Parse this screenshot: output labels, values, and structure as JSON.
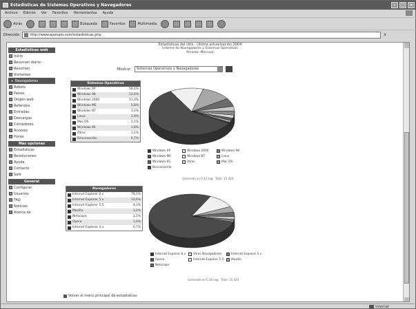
{
  "window": {
    "title": "Estadisticas de Sistemas Operativos y Navegadores"
  },
  "menubar": {
    "items": [
      "Archivo",
      "Edición",
      "Ver",
      "Favoritos",
      "Herramientas",
      "Ayuda"
    ]
  },
  "toolbar": {
    "back_label": "Atrás",
    "search_label": "Búsqueda",
    "favorites_label": "Favoritos",
    "multimedia_label": "Multimedia"
  },
  "address": {
    "label": "Dirección",
    "url": "http://www.ejemplo.com/estadisticas.php",
    "go_label": "Ir"
  },
  "sidebar": {
    "sections": [
      {
        "heading": "Estadisticas web",
        "items": [
          {
            "label": "Inicio"
          },
          {
            "label": "Resumen diario"
          },
          {
            "label": "Resumen"
          },
          {
            "label": "Visitantes"
          },
          {
            "label": "Navegadores",
            "selected": true
          },
          {
            "label": "Robots"
          },
          {
            "label": "Paises"
          },
          {
            "label": "Origen web"
          },
          {
            "label": "Referidos"
          },
          {
            "label": "Entradas"
          },
          {
            "label": "Descargas"
          },
          {
            "label": "Contadores"
          },
          {
            "label": "Accesos"
          },
          {
            "label": "Horas"
          }
        ]
      },
      {
        "heading": "Mas opciones",
        "items": [
          {
            "label": "Estadisticas"
          },
          {
            "label": "Resoluciones"
          },
          {
            "label": "Ayuda"
          },
          {
            "label": "Contacto"
          },
          {
            "label": "Salir"
          }
        ]
      },
      {
        "heading": "General",
        "items": [
          {
            "label": "Configurar"
          },
          {
            "label": "Usuarios"
          },
          {
            "label": "FAQ"
          },
          {
            "label": "Noticias"
          },
          {
            "label": "Acerca de"
          }
        ]
      }
    ]
  },
  "header": {
    "line1": "Estadisticas del sitio · Última actualización 2004",
    "line2": "Informe de Navegadores y Sistemas Operativos",
    "line3": "Periodo: Mensual"
  },
  "filter": {
    "label": "Mostrar:",
    "value": "Sistemas Operativos y Navegadores"
  },
  "os_table": {
    "heading": "Sistemas Operativos",
    "rows": [
      {
        "name": "Windows XP",
        "pct": "58,4%"
      },
      {
        "name": "Windows 98",
        "pct": "12,6%"
      },
      {
        "name": "Windows 2000",
        "pct": "11,3%"
      },
      {
        "name": "Windows ME",
        "pct": "5,8%"
      },
      {
        "name": "Windows NT",
        "pct": "3,2%"
      },
      {
        "name": "Linux",
        "pct": "2,9%"
      },
      {
        "name": "Mac OS",
        "pct": "2,1%"
      },
      {
        "name": "Windows 95",
        "pct": "1,8%"
      },
      {
        "name": "Otros",
        "pct": "1,2%"
      },
      {
        "name": "Desconocido",
        "pct": "0,7%"
      }
    ]
  },
  "os_legend": [
    "Windows XP",
    "Windows 2000",
    "Windows 98",
    "Windows ME",
    "Windows NT",
    "Linux",
    "Windows 95",
    "Otros",
    "Mac OS",
    "Desconocido"
  ],
  "os_generated": "Generado en 0,32 seg · Total: 15.420",
  "browser_table": {
    "heading": "Navegadores",
    "rows": [
      {
        "name": "Internet Explorer 6.x",
        "pct": "78,1%"
      },
      {
        "name": "Internet Explorer 5.x",
        "pct": "10,6%"
      },
      {
        "name": "Internet Explorer 5.5",
        "pct": "4,3%"
      },
      {
        "name": "Mozilla",
        "pct": "3,2%"
      },
      {
        "name": "Netscape",
        "pct": "2,1%"
      },
      {
        "name": "Opera",
        "pct": "1,0%"
      },
      {
        "name": "Internet Explorer 4.x",
        "pct": "0,7%"
      }
    ]
  },
  "browser_legend": [
    "Internet Explorer 6.x",
    "Otros Navegadores",
    "Internet Explorer 5.x",
    "Opera",
    "Internet Explorer 5.5",
    "Mozilla",
    "Netscape"
  ],
  "browser_generated": "Generado en 0,28 seg · Total: 15.420",
  "bottom_link": "Volver al menu principal de estadisticas",
  "status": {
    "zone": "Internet"
  },
  "chart_data": [
    {
      "type": "pie",
      "categories": [
        "Windows XP",
        "Windows 98",
        "Windows 2000",
        "Windows ME",
        "Windows NT",
        "Linux",
        "Mac OS",
        "Windows 95",
        "Otros",
        "Desconocido"
      ],
      "values": [
        58.4,
        12.6,
        11.3,
        5.8,
        3.2,
        2.9,
        2.1,
        1.8,
        1.2,
        0.7
      ]
    },
    {
      "type": "pie",
      "categories": [
        "Internet Explorer 6.x",
        "Internet Explorer 5.x",
        "Internet Explorer 5.5",
        "Mozilla",
        "Netscape",
        "Opera",
        "Internet Explorer 4.x"
      ],
      "values": [
        78.1,
        10.6,
        4.3,
        3.2,
        2.1,
        1.0,
        0.7
      ]
    }
  ],
  "colors": {
    "pie_main": "#4a4a4a",
    "pie_side": "#2f2f2f",
    "pie_light": "#f0f0f0",
    "pie_mid": "#a8a8a8",
    "pie_dark": "#6a6a6a"
  }
}
